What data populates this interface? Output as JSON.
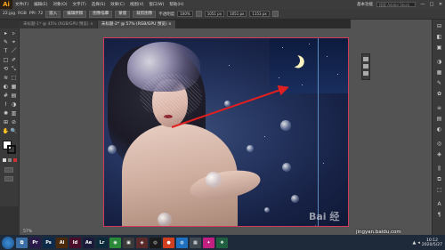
{
  "app": {
    "logo": "Ai"
  },
  "menubar": {
    "items": [
      "文件(F)",
      "编辑(E)",
      "对象(O)",
      "文字(T)",
      "选择(S)",
      "效果(C)",
      "视图(V)",
      "窗口(W)",
      "帮助(H)"
    ],
    "workspace": "基本功能",
    "search_placeholder": "搜索 Adobe Stock",
    "window_controls": [
      "—",
      "□",
      "✕"
    ]
  },
  "controlbar": {
    "filename": "22.jpg",
    "color_mode": "RGB",
    "ppi": "PPI: 72",
    "embed_button": "嵌入",
    "edit_original": "编辑原稿",
    "image_trace": "图像描摹",
    "mask": "蒙版",
    "crop_image": "裁剪图像",
    "opacity_label": "不透明度",
    "opacity": "100%",
    "x": "1051 px",
    "y": "1051 px",
    "w": "1153 px"
  },
  "tabs": [
    {
      "label": "未标题-1* @ 45% (RGB/GPU 预览)",
      "close": "×",
      "active": false
    },
    {
      "label": "未标题-2* @ 57% (RGB/GPU 预览)",
      "close": "×",
      "active": true
    }
  ],
  "tools": [
    "▸",
    "▹",
    "✎",
    "⌖",
    "T",
    "／",
    "□",
    "✐",
    "⟲",
    "⤡",
    "✋",
    "🔍"
  ],
  "statusbar": {
    "zoom": "57%"
  },
  "watermark": "Bai 经验",
  "site_url": "jingyan.baidu.com",
  "taskbar": {
    "apps": [
      {
        "label": "⧉",
        "color": "#3a6ea5"
      },
      {
        "label": "Pr",
        "color": "#2a1a4a"
      },
      {
        "label": "Ps",
        "color": "#0d2a4a"
      },
      {
        "label": "Ai",
        "color": "#4a2a0a"
      },
      {
        "label": "Id",
        "color": "#4a0d2a"
      },
      {
        "label": "Ae",
        "color": "#1a1a3a"
      },
      {
        "label": "Lr",
        "color": "#0d2a3a"
      },
      {
        "label": "◉",
        "color": "#2a8a3a"
      },
      {
        "label": "▣",
        "color": "#3a3a3a"
      },
      {
        "label": "◈",
        "color": "#5a2a2a"
      },
      {
        "label": "◎",
        "color": "#1a1a1a"
      },
      {
        "label": "●",
        "color": "#d04020"
      },
      {
        "label": "◍",
        "color": "#2070c0"
      },
      {
        "label": "▦",
        "color": "#404850"
      },
      {
        "label": "✦",
        "color": "#c02080"
      },
      {
        "label": "❖",
        "color": "#206040"
      }
    ],
    "clock_time": "10:12",
    "clock_date": "2020/5/27"
  }
}
